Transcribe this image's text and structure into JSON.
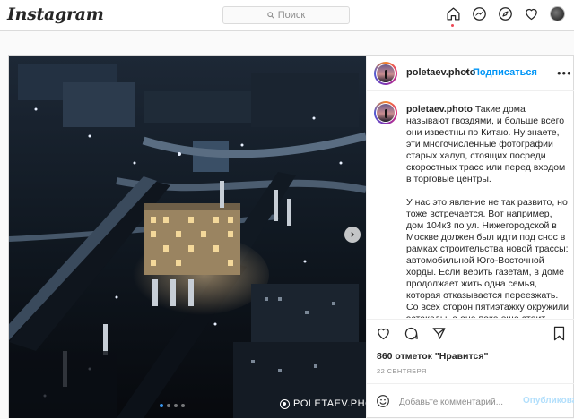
{
  "app": {
    "logo": "Instagram"
  },
  "search": {
    "placeholder": "Поиск",
    "icon": "search-icon"
  },
  "nav_icons": [
    "home-icon",
    "messenger-icon",
    "explore-icon",
    "heart-icon",
    "profile-avatar"
  ],
  "colors": {
    "accent": "#0095f6",
    "notification_dot": "#ed4956",
    "border": "#dbdbdb",
    "muted": "#8e8e8e"
  },
  "post": {
    "username": "poletaev.photo",
    "separator": "•",
    "follow_label": "Подписаться",
    "more_label": "•••",
    "caption_username": "poletaev.photo",
    "caption_p1": "Такие дома называют гвоздями, и больше всего они известны по Китаю. Ну знаете, эти многочисленные фотографии старых халуп, стоящих посреди скоростных трасс или перед входом в торговые центры.",
    "caption_p2": "У нас это явление не так развито, но тоже встречается. Вот например, дом 104к3 по ул. Нижегородской в Москве должен был идти под снос в рамках строительства новой трассы: автомобильной Юго-Восточной хорды. Если верить газетам, в доме продолжает жить одна семья, которая отказывается переезжать. Со всех сторон пятиэтажку окружили эстакады, а она пока еще стоит.",
    "watermark": "POLETAEV.PHOTO",
    "carousel": {
      "total": 4,
      "active": 1
    },
    "likes": "860 отметок \"Нравится\"",
    "date": "22 СЕНТЯБРЯ",
    "comment_placeholder": "Добавьте комментарий...",
    "publish_label": "Опубликовать"
  }
}
